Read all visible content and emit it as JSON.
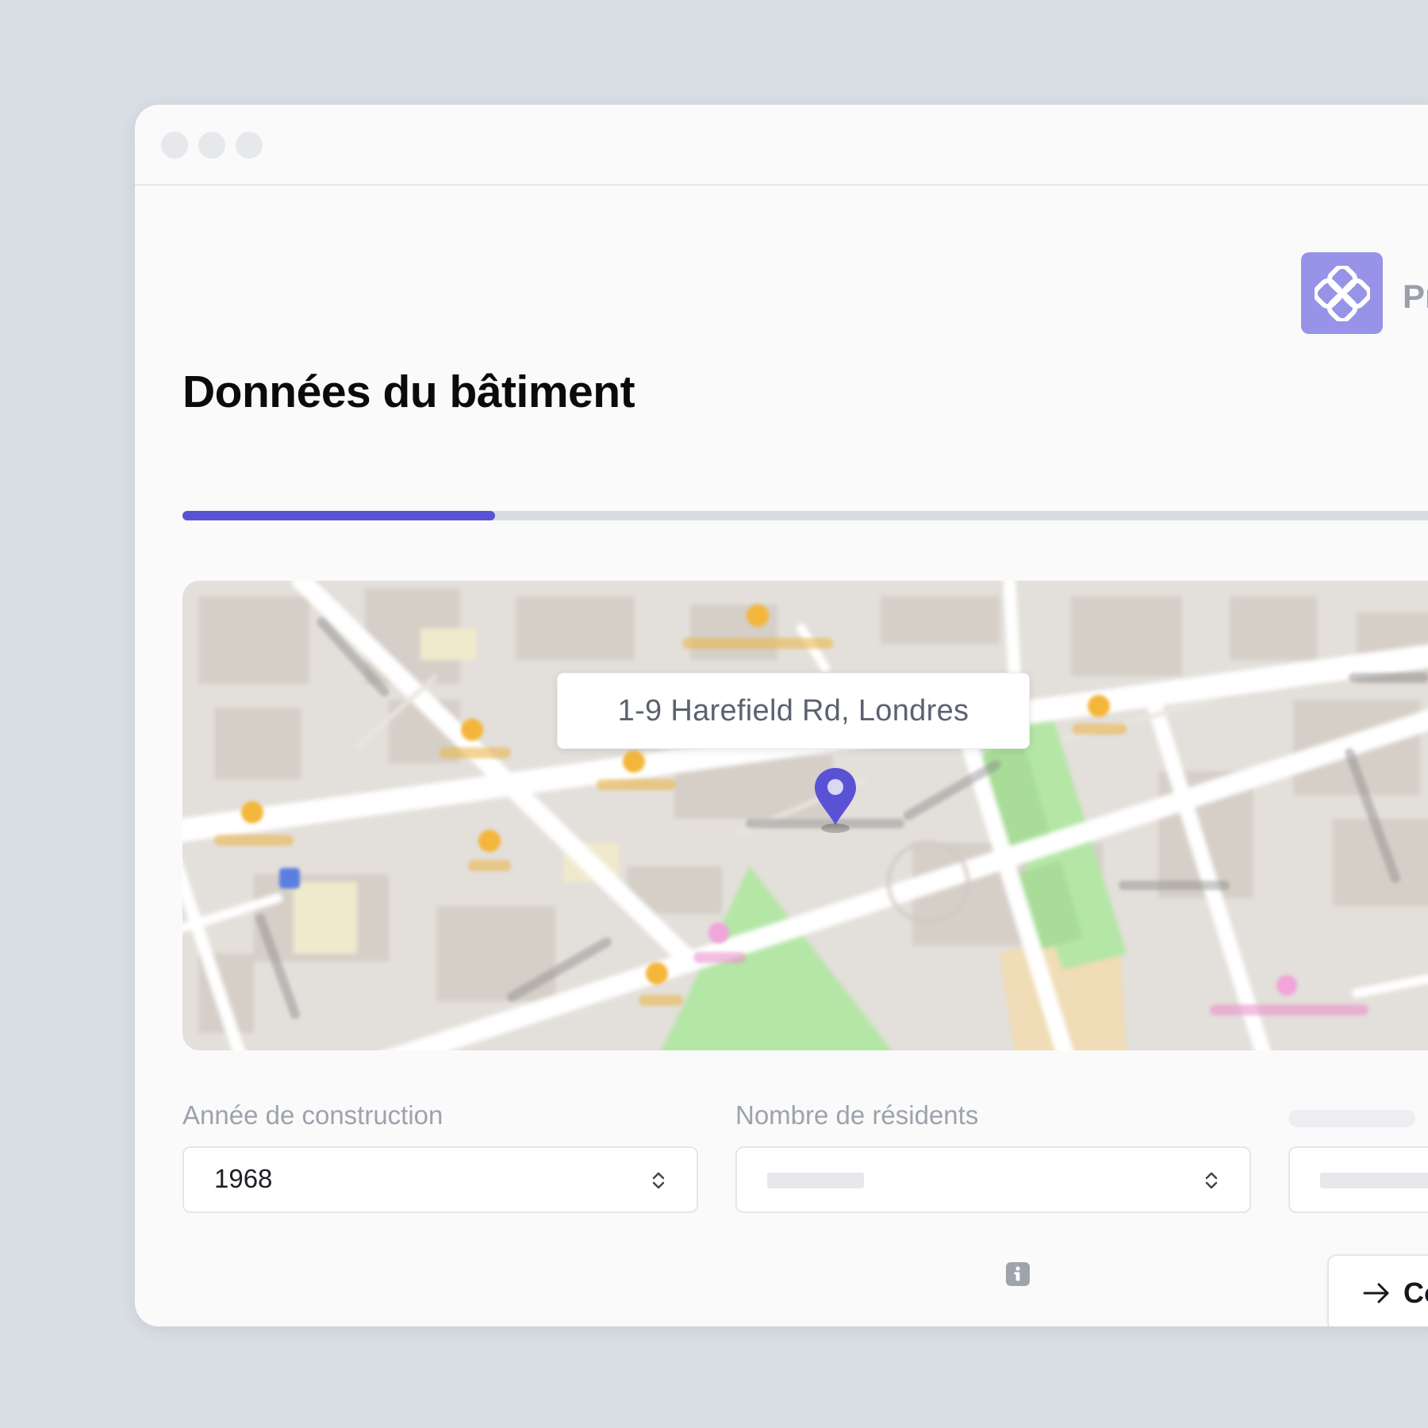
{
  "page": {
    "title": "Données du bâtiment",
    "brand_name": "Pr",
    "progress_fraction": 0.24
  },
  "map": {
    "address": "1-9 Harefield Rd, Londres"
  },
  "form": {
    "construction_year": {
      "label": "Année de construction",
      "value": "1968"
    },
    "residents": {
      "label": "Nombre de résidents"
    }
  },
  "actions": {
    "continue_label": "Co"
  },
  "colors": {
    "accent": "#5a52d5",
    "logo_bg": "#9793e8",
    "park_green": "#b4e6a6"
  },
  "icons": {
    "logo": "clover-logo-icon",
    "map_pin": "location-pin-icon",
    "chevrons": "chevron-up-down-icon",
    "info": "info-icon",
    "arrow": "arrow-right-icon"
  }
}
